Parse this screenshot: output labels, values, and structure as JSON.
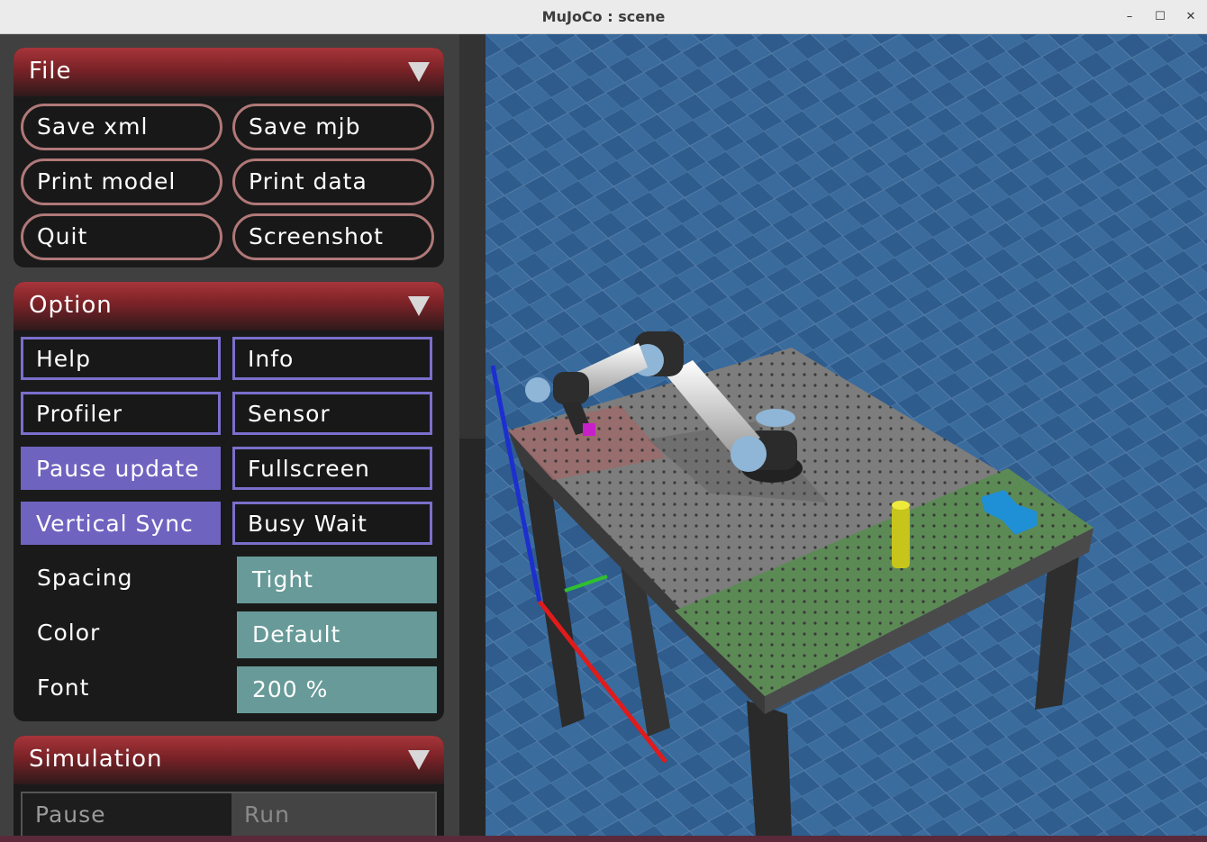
{
  "window": {
    "title": "MuJoCo : scene",
    "minimize_glyph": "–",
    "maximize_glyph": "☐",
    "close_glyph": "✕"
  },
  "file": {
    "title": "File",
    "buttons": [
      "Save xml",
      "Save mjb",
      "Print model",
      "Print data",
      "Quit",
      "Screenshot"
    ]
  },
  "option": {
    "title": "Option",
    "checks": [
      {
        "label": "Help",
        "on": false
      },
      {
        "label": "Info",
        "on": false
      },
      {
        "label": "Profiler",
        "on": false
      },
      {
        "label": "Sensor",
        "on": false
      },
      {
        "label": "Pause update",
        "on": true
      },
      {
        "label": "Fullscreen",
        "on": false
      },
      {
        "label": "Vertical Sync",
        "on": true
      },
      {
        "label": "Busy Wait",
        "on": false
      }
    ],
    "selects": [
      {
        "label": "Spacing",
        "value": "Tight"
      },
      {
        "label": "Color",
        "value": "Default"
      },
      {
        "label": "Font",
        "value": "200 %"
      }
    ]
  },
  "simulation": {
    "title": "Simulation",
    "pause_label": "Pause",
    "run_label": "Run"
  },
  "colors": {
    "header_red": "#a7353a",
    "check_on": "#6e63bf",
    "select_teal": "#679a98",
    "floor_blue": "#2d5888",
    "table_gray": "#7d7d7d",
    "zone_green": "#5c8a55",
    "zone_red": "#9c6a6a"
  }
}
